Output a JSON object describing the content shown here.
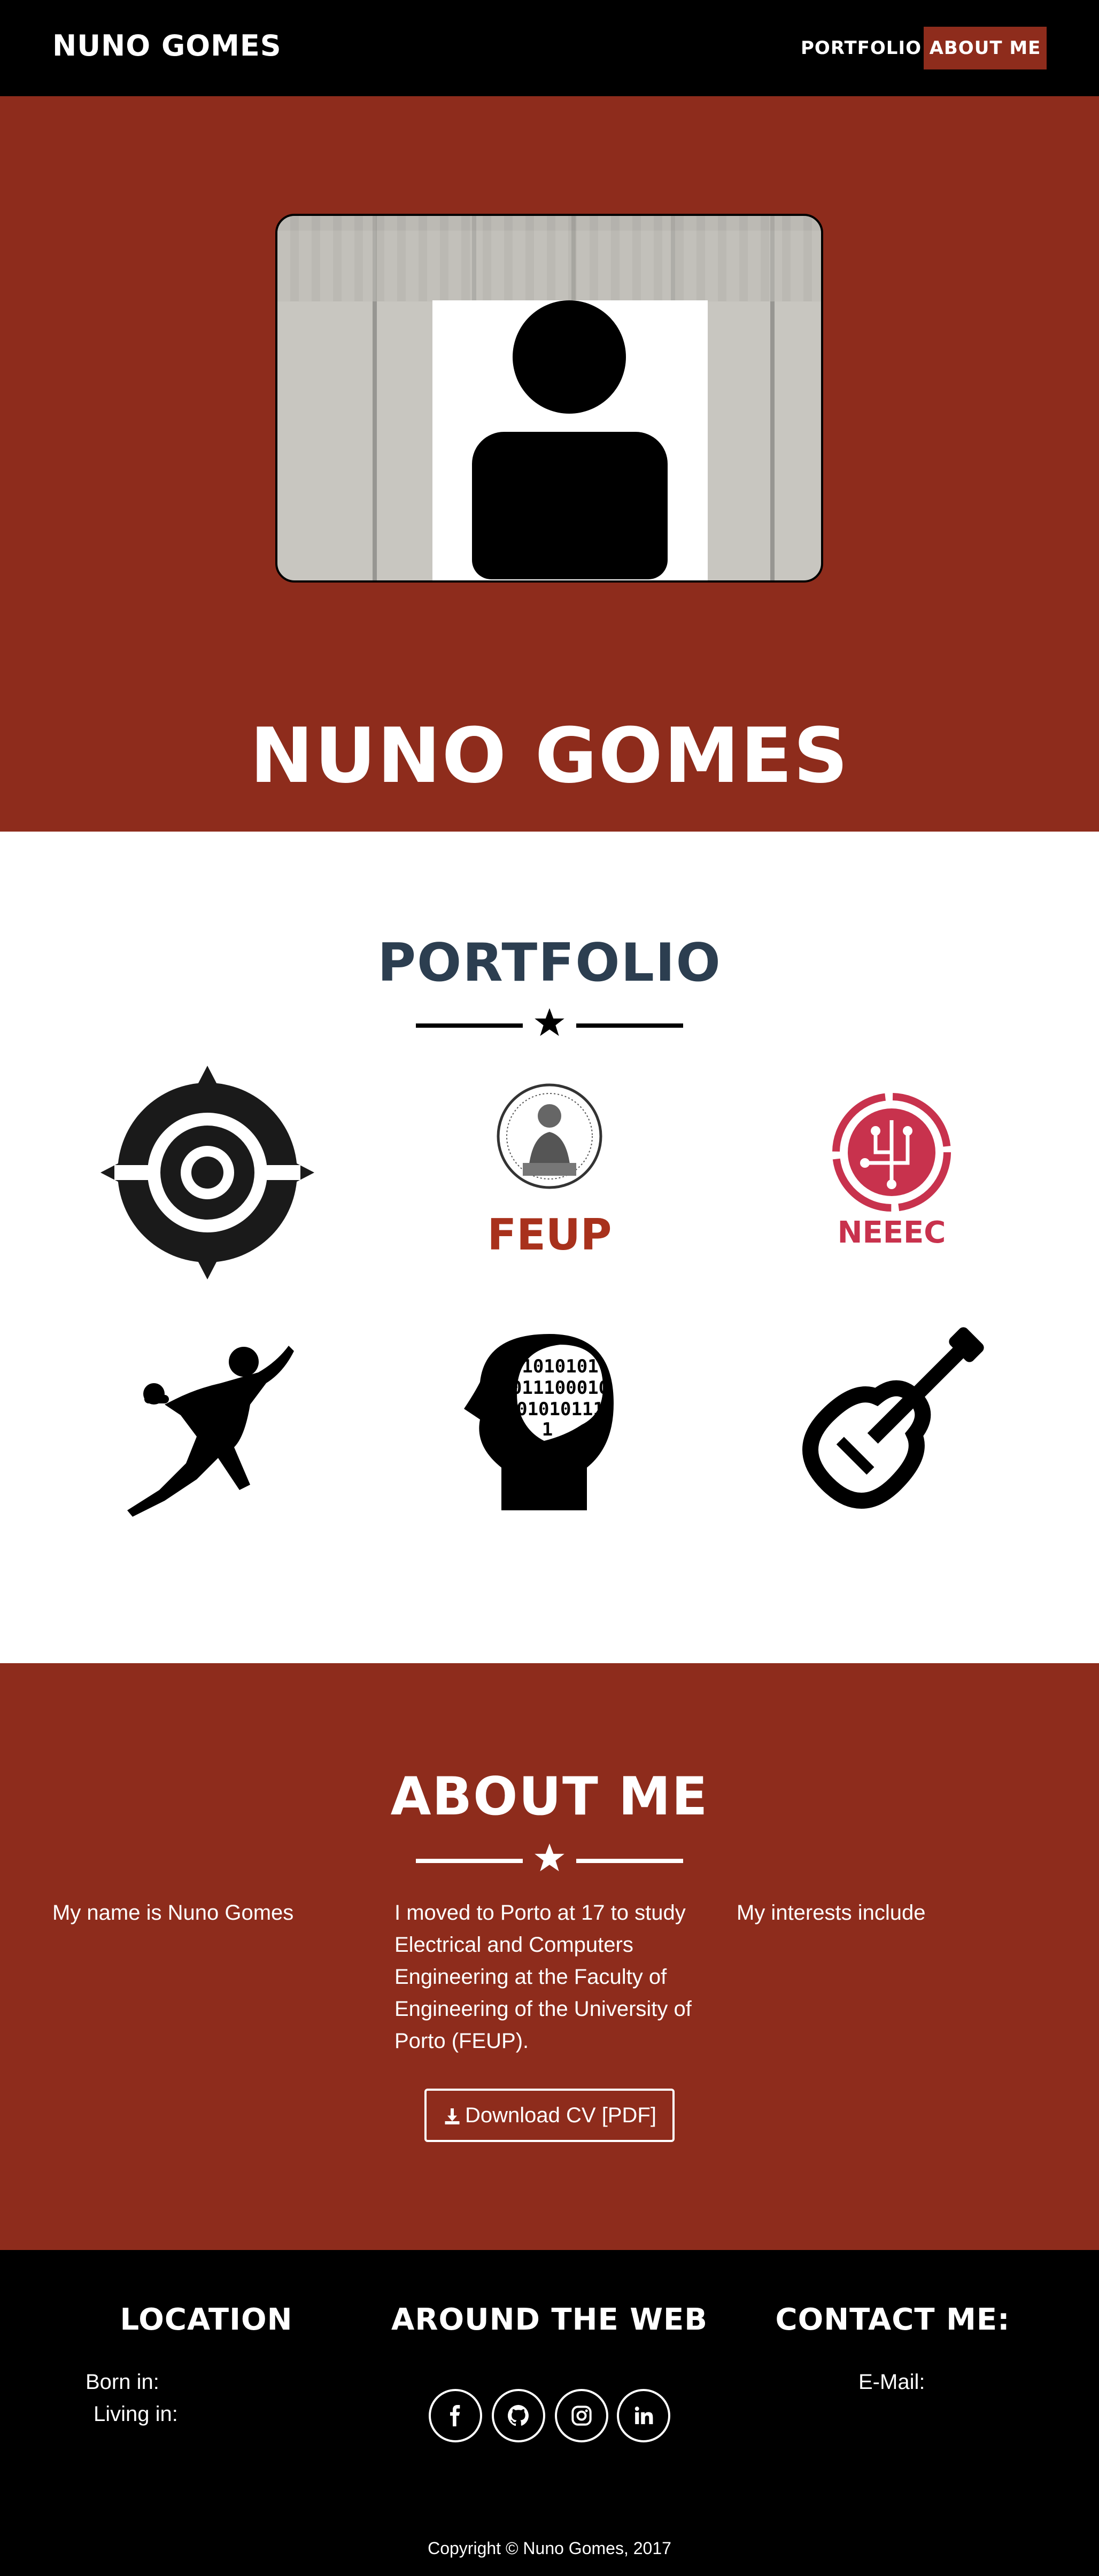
{
  "nav": {
    "brand": "NUNO GOMES",
    "links": [
      {
        "label": "PORTFOLIO"
      },
      {
        "label": "ABOUT ME",
        "active": true
      }
    ]
  },
  "hero": {
    "name": "NUNO GOMES",
    "photo_icon": "user-silhouette-icon"
  },
  "portfolio": {
    "title": "PORTFOLIO",
    "items": [
      {
        "icon": "crosshair-emblem-icon"
      },
      {
        "icon": "feup-logo-icon",
        "label": "FEUP"
      },
      {
        "icon": "neeec-logo-icon",
        "label": "NEEEC"
      },
      {
        "icon": "handball-player-icon"
      },
      {
        "icon": "binary-head-icon",
        "binary_lines": [
          "1010101",
          "011100010",
          "01010111",
          "1"
        ]
      },
      {
        "icon": "guitar-icon"
      }
    ]
  },
  "about": {
    "title": "ABOUT ME",
    "col1": "My name is Nuno Gomes",
    "col2": "I moved to Porto at 17 to study Electrical and Computers Engineering at the Faculty of Engineering of the University of Porto (FEUP).",
    "col3": "My interests include",
    "cv_button": "Download CV [PDF]"
  },
  "footer": {
    "location_title": "LOCATION",
    "born_label": "Born in:",
    "living_label": "Living in:",
    "web_title": "AROUND THE WEB",
    "social": [
      "facebook-icon",
      "github-icon",
      "instagram-icon",
      "linkedin-icon"
    ],
    "contact_title": "CONTACT ME:",
    "email_label": "E-Mail:",
    "copyright": "Copyright © Nuno Gomes, 2017"
  },
  "colors": {
    "accent": "#8E2C1C",
    "dark": "#000000",
    "heading_dark": "#2C3E50",
    "feup_red": "#A8311C",
    "neeec_pink": "#C8324D"
  }
}
